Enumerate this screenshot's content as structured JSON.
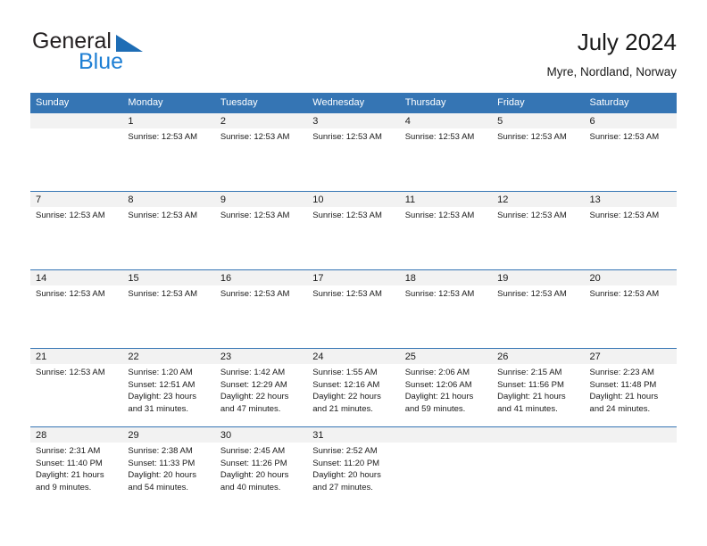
{
  "brand": {
    "name_part1": "General",
    "name_part2": "Blue",
    "triangle_color": "#1e6db5",
    "blue_text_color": "#1e7fd4"
  },
  "header": {
    "title": "July 2024",
    "subtitle": "Myre, Nordland, Norway",
    "accent_color": "#3575b4",
    "daynum_band_color": "#f2f2f2"
  },
  "weekdays": [
    "Sunday",
    "Monday",
    "Tuesday",
    "Wednesday",
    "Thursday",
    "Friday",
    "Saturday"
  ],
  "weeks": [
    {
      "days": [
        {
          "num": "",
          "lines": []
        },
        {
          "num": "1",
          "lines": [
            "Sunrise: 12:53 AM"
          ]
        },
        {
          "num": "2",
          "lines": [
            "Sunrise: 12:53 AM"
          ]
        },
        {
          "num": "3",
          "lines": [
            "Sunrise: 12:53 AM"
          ]
        },
        {
          "num": "4",
          "lines": [
            "Sunrise: 12:53 AM"
          ]
        },
        {
          "num": "5",
          "lines": [
            "Sunrise: 12:53 AM"
          ]
        },
        {
          "num": "6",
          "lines": [
            "Sunrise: 12:53 AM"
          ]
        }
      ]
    },
    {
      "days": [
        {
          "num": "7",
          "lines": [
            "Sunrise: 12:53 AM"
          ]
        },
        {
          "num": "8",
          "lines": [
            "Sunrise: 12:53 AM"
          ]
        },
        {
          "num": "9",
          "lines": [
            "Sunrise: 12:53 AM"
          ]
        },
        {
          "num": "10",
          "lines": [
            "Sunrise: 12:53 AM"
          ]
        },
        {
          "num": "11",
          "lines": [
            "Sunrise: 12:53 AM"
          ]
        },
        {
          "num": "12",
          "lines": [
            "Sunrise: 12:53 AM"
          ]
        },
        {
          "num": "13",
          "lines": [
            "Sunrise: 12:53 AM"
          ]
        }
      ]
    },
    {
      "days": [
        {
          "num": "14",
          "lines": [
            "Sunrise: 12:53 AM"
          ]
        },
        {
          "num": "15",
          "lines": [
            "Sunrise: 12:53 AM"
          ]
        },
        {
          "num": "16",
          "lines": [
            "Sunrise: 12:53 AM"
          ]
        },
        {
          "num": "17",
          "lines": [
            "Sunrise: 12:53 AM"
          ]
        },
        {
          "num": "18",
          "lines": [
            "Sunrise: 12:53 AM"
          ]
        },
        {
          "num": "19",
          "lines": [
            "Sunrise: 12:53 AM"
          ]
        },
        {
          "num": "20",
          "lines": [
            "Sunrise: 12:53 AM"
          ]
        }
      ]
    },
    {
      "days": [
        {
          "num": "21",
          "lines": [
            "Sunrise: 12:53 AM"
          ]
        },
        {
          "num": "22",
          "lines": [
            "Sunrise: 1:20 AM",
            "Sunset: 12:51 AM",
            "Daylight: 23 hours and 31 minutes."
          ]
        },
        {
          "num": "23",
          "lines": [
            "Sunrise: 1:42 AM",
            "Sunset: 12:29 AM",
            "Daylight: 22 hours and 47 minutes."
          ]
        },
        {
          "num": "24",
          "lines": [
            "Sunrise: 1:55 AM",
            "Sunset: 12:16 AM",
            "Daylight: 22 hours and 21 minutes."
          ]
        },
        {
          "num": "25",
          "lines": [
            "Sunrise: 2:06 AM",
            "Sunset: 12:06 AM",
            "Daylight: 21 hours and 59 minutes."
          ]
        },
        {
          "num": "26",
          "lines": [
            "Sunrise: 2:15 AM",
            "Sunset: 11:56 PM",
            "Daylight: 21 hours and 41 minutes."
          ]
        },
        {
          "num": "27",
          "lines": [
            "Sunrise: 2:23 AM",
            "Sunset: 11:48 PM",
            "Daylight: 21 hours and 24 minutes."
          ]
        }
      ]
    },
    {
      "days": [
        {
          "num": "28",
          "lines": [
            "Sunrise: 2:31 AM",
            "Sunset: 11:40 PM",
            "Daylight: 21 hours and 9 minutes."
          ]
        },
        {
          "num": "29",
          "lines": [
            "Sunrise: 2:38 AM",
            "Sunset: 11:33 PM",
            "Daylight: 20 hours and 54 minutes."
          ]
        },
        {
          "num": "30",
          "lines": [
            "Sunrise: 2:45 AM",
            "Sunset: 11:26 PM",
            "Daylight: 20 hours and 40 minutes."
          ]
        },
        {
          "num": "31",
          "lines": [
            "Sunrise: 2:52 AM",
            "Sunset: 11:20 PM",
            "Daylight: 20 hours and 27 minutes."
          ]
        },
        {
          "num": "",
          "lines": []
        },
        {
          "num": "",
          "lines": []
        },
        {
          "num": "",
          "lines": []
        }
      ]
    }
  ]
}
